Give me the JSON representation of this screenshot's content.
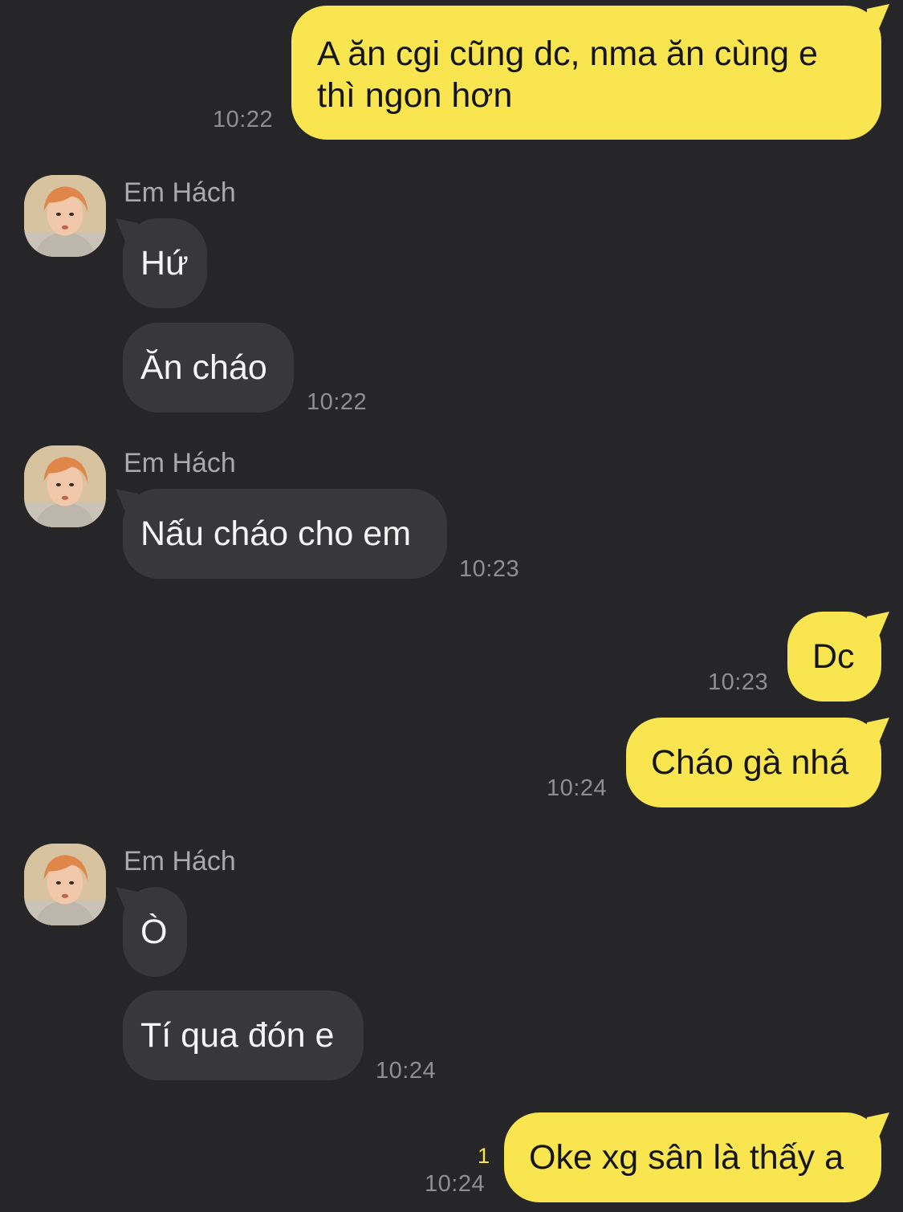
{
  "contact": {
    "name": "Em Hách"
  },
  "messages": [
    {
      "id": "m1",
      "side": "sent",
      "text": "A ăn cgi cũng dc, nma ăn cùng e thì ngon hơn",
      "time": "10:22"
    },
    {
      "id": "m2",
      "side": "recv",
      "text": "Hứ",
      "time": ""
    },
    {
      "id": "m3",
      "side": "recv",
      "text": "Ăn cháo",
      "time": "10:22"
    },
    {
      "id": "m4",
      "side": "recv",
      "text": "Nấu cháo cho em",
      "time": "10:23"
    },
    {
      "id": "m5",
      "side": "sent",
      "text": "Dc",
      "time": "10:23"
    },
    {
      "id": "m6",
      "side": "sent",
      "text": "Cháo gà nhá",
      "time": "10:24"
    },
    {
      "id": "m7",
      "side": "recv",
      "text": "Ò",
      "time": ""
    },
    {
      "id": "m8",
      "side": "recv",
      "text": "Tí qua đón e",
      "time": "10:24"
    },
    {
      "id": "m9",
      "side": "sent",
      "text": "Oke xg sân là thấy a",
      "time": "10:24",
      "unread_count": "1"
    }
  ],
  "colors": {
    "background": "#262628",
    "sent_bubble": "#f9e550",
    "received_bubble": "#38383b",
    "timestamp": "#8e8e93",
    "unread_indicator": "#f9e550"
  },
  "icons": {
    "avatar": "contact-avatar-photo"
  }
}
